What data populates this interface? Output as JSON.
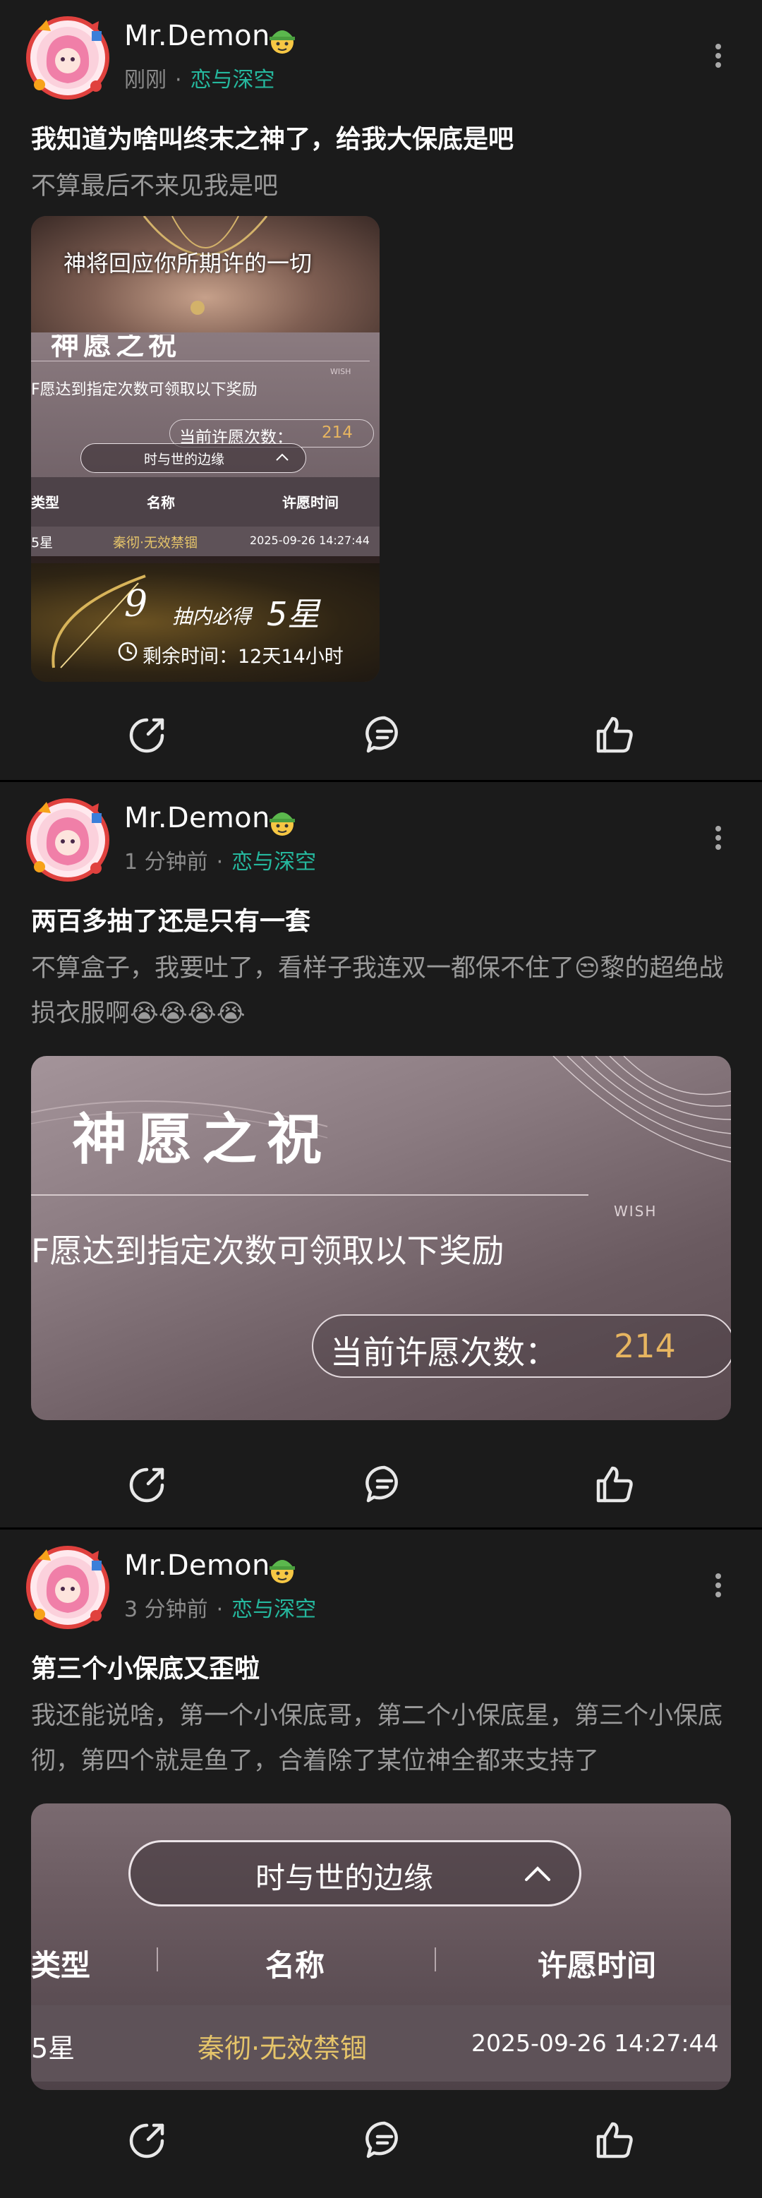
{
  "posts": [
    {
      "user": "Mr.Demon",
      "time": "刚刚",
      "topic": "恋与深空",
      "title": "我知道为啥叫终末之神了，给我大保底是吧",
      "body": "不算最后不来见我是吧",
      "image": {
        "banner": "神将回应你所期许的一切",
        "heading": "神愿之祝",
        "subtitle": "F愿达到指定次数可领取以下奖励",
        "count_label": "当前许愿次数：",
        "count_value": "214",
        "dropdown": "时与世的边缘",
        "col_type": "类型",
        "col_name": "名称",
        "col_time": "许愿时间",
        "row_type": "5星",
        "row_name": "秦彻·无效禁锢",
        "row_time": "2025-09-26 14:27:44",
        "pity_number": "9",
        "pity_text": "抽内必得",
        "pity_star": "5星",
        "remaining": "剩余时间：12天14小时",
        "wish_tag": "WISH"
      }
    },
    {
      "user": "Mr.Demon",
      "time": "1 分钟前",
      "topic": "恋与深空",
      "title": "两百多抽了还是只有一套",
      "body": "不算盒子，我要吐了，看样子我连双一都保不住了😒黎的超绝战损衣服啊😭😭😭😭",
      "image": {
        "heading": "神愿之祝",
        "wish_tag": "WISH",
        "subtitle": "F愿达到指定次数可领取以下奖励",
        "count_label": "当前许愿次数：",
        "count_value": "214"
      }
    },
    {
      "user": "Mr.Demon",
      "time": "3 分钟前",
      "topic": "恋与深空",
      "title": "第三个小保底又歪啦",
      "body": "我还能说啥，第一个小保底哥，第二个小保底星，第三个小保底彻，第四个就是鱼了，合着除了某位神全都来支持了",
      "image": {
        "dropdown": "时与世的边缘",
        "col_type": "类型",
        "col_name": "名称",
        "col_time": "许愿时间",
        "row_type": "5星",
        "row_name": "秦彻·无效禁锢",
        "row_time": "2025-09-26 14:27:44"
      }
    }
  ],
  "icons": {
    "share": "share-icon",
    "comment": "comment-icon",
    "like": "thumbs-up-icon",
    "more": "more-vertical-icon",
    "badge": "green-hat-emoji-badge-icon"
  },
  "colors": {
    "background": "#1b1b1b",
    "divider": "#000000",
    "topic": "#25b89e",
    "meta": "#8b8b8b",
    "gold": "#d8b45a"
  }
}
